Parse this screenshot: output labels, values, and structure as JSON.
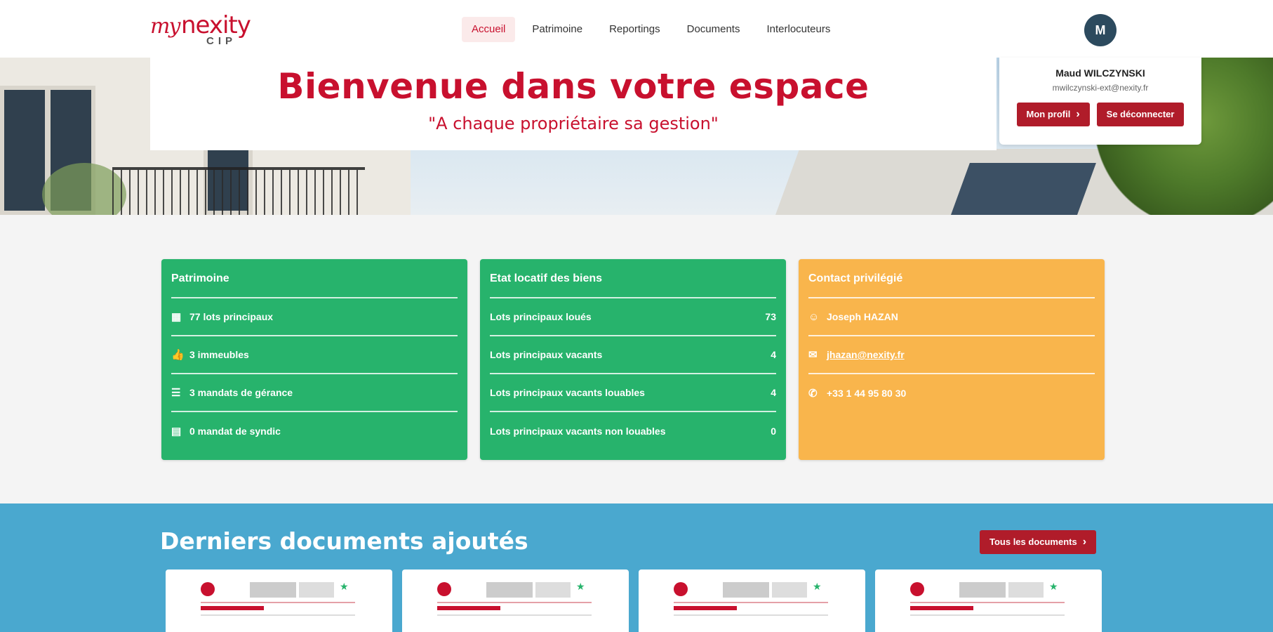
{
  "header": {
    "logo": {
      "script": "my",
      "brand": "nexity",
      "sub": "CIP"
    },
    "nav": [
      {
        "label": "Accueil",
        "active": true
      },
      {
        "label": "Patrimoine",
        "active": false
      },
      {
        "label": "Reportings",
        "active": false
      },
      {
        "label": "Documents",
        "active": false
      },
      {
        "label": "Interlocuteurs",
        "active": false
      }
    ],
    "avatar_initial": "M"
  },
  "hero": {
    "title": "Bienvenue dans votre espace",
    "tagline": "\"A chaque propriétaire sa gestion\""
  },
  "profile": {
    "name": "Maud WILCZYNSKI",
    "email": "mwilczynski-ext@nexity.fr",
    "profile_button": "Mon profil",
    "logout_button": "Se déconnecter"
  },
  "cards": {
    "patrimoine": {
      "title": "Patrimoine",
      "rows": [
        {
          "icon": "building-icon",
          "glyph": "▦",
          "label": "77 lots principaux"
        },
        {
          "icon": "thumb-icon",
          "glyph": "👍",
          "label": "3 immeubles"
        },
        {
          "icon": "mandate-icon",
          "glyph": "☰",
          "label": "3 mandats de gérance"
        },
        {
          "icon": "document-icon",
          "glyph": "▤",
          "label": "0 mandat de syndic"
        }
      ]
    },
    "etat_locatif": {
      "title": "Etat locatif des biens",
      "rows": [
        {
          "label": "Lots principaux loués",
          "value": "73"
        },
        {
          "label": "Lots principaux vacants",
          "value": "4"
        },
        {
          "label": "Lots principaux vacants louables",
          "value": "4"
        },
        {
          "label": "Lots principaux vacants non louables",
          "value": "0"
        }
      ]
    },
    "contact": {
      "title": "Contact privilégié",
      "name": "Joseph HAZAN",
      "email": "jhazan@nexity.fr",
      "phone": "+33 1 44 95 80 30"
    }
  },
  "documents": {
    "title": "Derniers documents ajoutés",
    "all_button": "Tous les documents"
  },
  "colors": {
    "brand_red": "#c8102e",
    "button_red": "#b01c2a",
    "green": "#27b36c",
    "orange": "#f9b54c",
    "blue": "#4aa8cf"
  }
}
